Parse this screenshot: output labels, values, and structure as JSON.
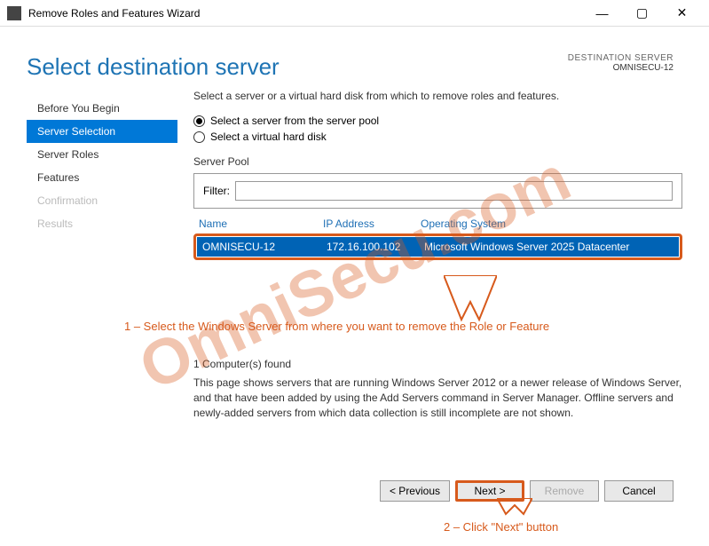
{
  "window": {
    "title": "Remove Roles and Features Wizard"
  },
  "header": {
    "title": "Select destination server",
    "dest_label": "DESTINATION SERVER",
    "dest_value": "OMNISECU-12"
  },
  "sidebar": {
    "items": [
      {
        "label": "Before You Begin",
        "state": "normal"
      },
      {
        "label": "Server Selection",
        "state": "active"
      },
      {
        "label": "Server Roles",
        "state": "normal"
      },
      {
        "label": "Features",
        "state": "normal"
      },
      {
        "label": "Confirmation",
        "state": "disabled"
      },
      {
        "label": "Results",
        "state": "disabled"
      }
    ]
  },
  "content": {
    "intro": "Select a server or a virtual hard disk from which to remove roles and features.",
    "radio1": "Select a server from the server pool",
    "radio2": "Select a virtual hard disk",
    "pool_label": "Server Pool",
    "filter_label": "Filter:",
    "filter_value": "",
    "columns": {
      "name": "Name",
      "ip": "IP Address",
      "os": "Operating System"
    },
    "rows": [
      {
        "name": "OMNISECU-12",
        "ip": "172.16.100.102",
        "os": "Microsoft Windows Server 2025 Datacenter"
      }
    ],
    "found": "1 Computer(s) found",
    "description": "This page shows servers that are running Windows Server 2012 or a newer release of Windows Server, and that have been added by using the Add Servers command in Server Manager. Offline servers and newly-added servers from which data collection is still incomplete are not shown."
  },
  "buttons": {
    "previous": "< Previous",
    "next": "Next >",
    "remove": "Remove",
    "cancel": "Cancel"
  },
  "annotations": {
    "a1": "1 – Select the Windows Server from where you want to remove the Role or Feature",
    "a2": "2 – Click \"Next\" button"
  },
  "watermark": "OmniSecu.com"
}
